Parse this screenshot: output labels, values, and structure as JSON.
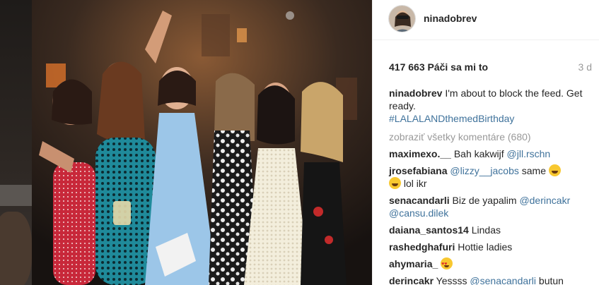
{
  "post": {
    "username": "ninadobrev",
    "likes": "417 663 Páči sa mi to",
    "age": "3 d",
    "caption": {
      "username": "ninadobrev",
      "text": "I'm about to block the feed. Get ready.",
      "hashtag": "#LALALANDthemedBirthday"
    },
    "view_all": "zobraziť všetky komentáre (680)"
  },
  "comments": [
    {
      "user": "maximexo.__",
      "text": " Bah kakwijf ",
      "mention": "@jll.rschn"
    },
    {
      "user": "jrosefabiana",
      "mention": "@lizzy__jacobs",
      "text": " same ",
      "emoji": "face-with-tears-of-joy-icon",
      "tail": " lol ikr"
    },
    {
      "user": "senacandarli",
      "text": " Biz de yapalim ",
      "mention": "@derincakr",
      "mention2": "@cansu.dilek"
    },
    {
      "user": "daiana_santos14",
      "text": " Lindas"
    },
    {
      "user": "rashedghafuri",
      "text": " Hottie ladies"
    },
    {
      "user": "ahymaria_",
      "emoji": "heart-eyes-icon"
    },
    {
      "user": "derincakr",
      "text": " Yessss ",
      "mention": "@senacandarli",
      "tail": " butun"
    }
  ]
}
